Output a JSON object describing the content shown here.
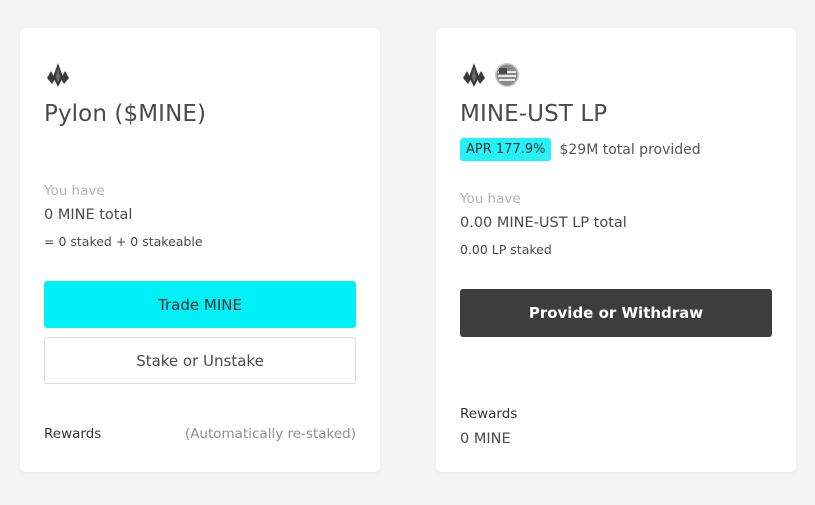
{
  "cards": [
    {
      "title": "Pylon ($MINE)",
      "icons": [
        "pylon-icon"
      ],
      "you_have_label": "You have",
      "total": "0 MINE total",
      "breakdown": "= 0 staked + 0 stakeable",
      "primary_button": "Trade MINE",
      "secondary_button": "Stake or Unstake",
      "rewards_label": "Rewards",
      "rewards_note": "(Automatically re-staked)"
    },
    {
      "title": "MINE-UST LP",
      "icons": [
        "pylon-icon",
        "ust-icon"
      ],
      "apr_badge": "APR 177.9%",
      "total_provided": "$29M total provided",
      "you_have_label": "You have",
      "total": "0.00 MINE-UST LP total",
      "staked": "0.00 LP staked",
      "primary_button": "Provide or Withdraw",
      "rewards_label": "Rewards",
      "rewards_value": "0 MINE"
    }
  ],
  "colors": {
    "accent_cyan": "#00f0f8",
    "dark_button": "#3d3d3d",
    "background": "#f4f4f4"
  }
}
